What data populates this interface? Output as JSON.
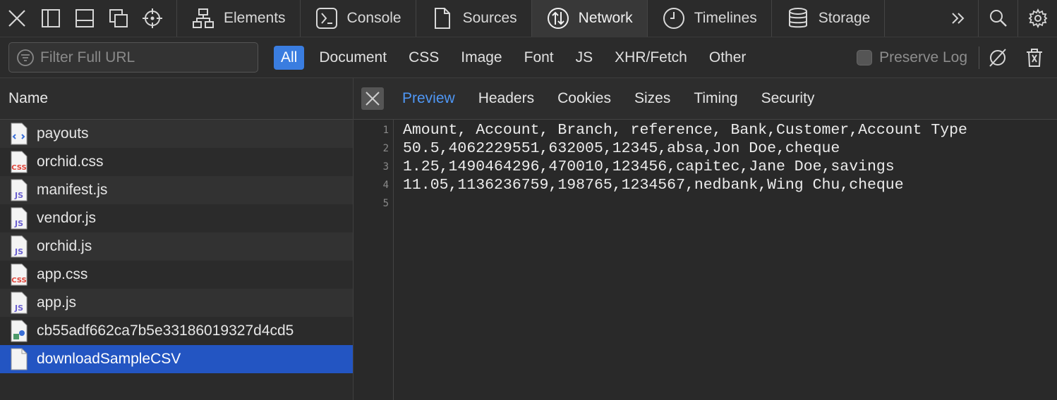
{
  "toolbar": {
    "left_icons": [
      "close-icon",
      "dock-left-icon",
      "dock-bottom-icon",
      "undock-icon",
      "inspect-icon"
    ],
    "tabs": [
      {
        "label": "Elements",
        "icon": "elements-icon",
        "active": false
      },
      {
        "label": "Console",
        "icon": "console-icon",
        "active": false
      },
      {
        "label": "Sources",
        "icon": "sources-icon",
        "active": false
      },
      {
        "label": "Network",
        "icon": "network-icon",
        "active": true
      },
      {
        "label": "Timelines",
        "icon": "timelines-icon",
        "active": false
      },
      {
        "label": "Storage",
        "icon": "storage-icon",
        "active": false
      }
    ],
    "right_icons": [
      "more-tabs-icon",
      "search-icon",
      "settings-icon"
    ]
  },
  "filterbar": {
    "placeholder": "Filter Full URL",
    "value": "",
    "types": [
      "All",
      "Document",
      "CSS",
      "Image",
      "Font",
      "JS",
      "XHR/Fetch",
      "Other"
    ],
    "active_type": "All",
    "preserve_log_label": "Preserve Log",
    "preserve_log_checked": false
  },
  "list": {
    "header": "Name",
    "items": [
      {
        "name": "payouts",
        "type": "document",
        "selected": false
      },
      {
        "name": "orchid.css",
        "type": "css",
        "selected": false
      },
      {
        "name": "manifest.js",
        "type": "js",
        "selected": false
      },
      {
        "name": "vendor.js",
        "type": "js",
        "selected": false
      },
      {
        "name": "orchid.js",
        "type": "js",
        "selected": false
      },
      {
        "name": "app.css",
        "type": "css",
        "selected": false
      },
      {
        "name": "app.js",
        "type": "js",
        "selected": false
      },
      {
        "name": "cb55adf662ca7b5e33186019327d4cd5",
        "type": "image",
        "selected": false
      },
      {
        "name": "downloadSampleCSV",
        "type": "other",
        "selected": true
      }
    ]
  },
  "detail": {
    "tabs": [
      "Preview",
      "Headers",
      "Cookies",
      "Sizes",
      "Timing",
      "Security"
    ],
    "active_tab": "Preview",
    "preview_lines": [
      "Amount, Account, Branch, reference, Bank,Customer,Account Type",
      "50.5,4062229551,632005,12345,absa,Jon Doe,cheque",
      "1.25,1490464296,470010,123456,capitec,Jane Doe,savings",
      "11.05,1136236759,198765,1234567,nedbank,Wing Chu,cheque",
      ""
    ],
    "line_numbers": [
      "1",
      "2",
      "3",
      "4",
      "5"
    ]
  },
  "colors": {
    "accent": "#3a7de0",
    "selected_row": "#2355c2",
    "active_detail_tab": "#4f97f5"
  }
}
